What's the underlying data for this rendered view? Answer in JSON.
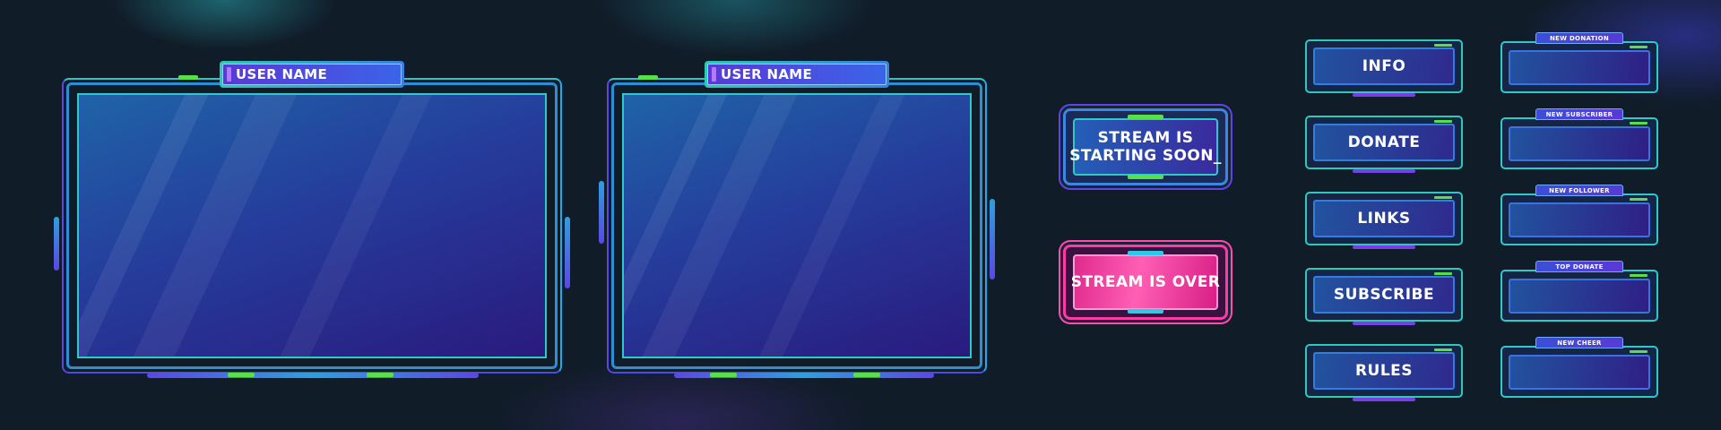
{
  "frames": [
    {
      "username": "USER NAME"
    },
    {
      "username": "USER NAME"
    }
  ],
  "status_panels": {
    "starting_line1": "STREAM IS",
    "starting_line2": "STARTING SOON_",
    "over": "STREAM IS OVER"
  },
  "nav_buttons": [
    "INFO",
    "DONATE",
    "LINKS",
    "SUBSCRIBE",
    "RULES"
  ],
  "alerts": [
    "NEW DONATION",
    "NEW SUBSCRIBER",
    "NEW FOLLOWER",
    "TOP DONATE",
    "NEW CHEER"
  ],
  "colors": {
    "background": "#101c28",
    "cyan": "#2ec9c8",
    "blue": "#2f7fe0",
    "purple": "#5b47e6",
    "green": "#56e04a",
    "pink": "#ff3aa8"
  }
}
